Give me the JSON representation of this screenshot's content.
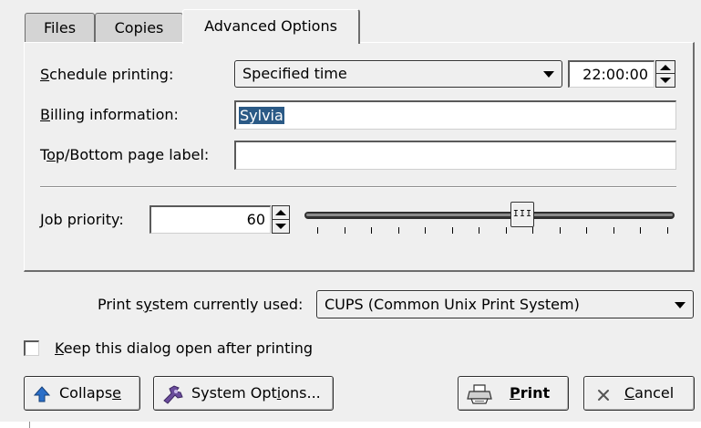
{
  "tabs": [
    {
      "label": "Files"
    },
    {
      "label": "Copies"
    },
    {
      "label": "Advanced Options"
    }
  ],
  "schedule": {
    "label_mnemonic": "S",
    "label_rest": "chedule printing:",
    "value": "Specified time",
    "time": "22:00:00"
  },
  "billing": {
    "label_mnemonic": "B",
    "label_rest": "illing information:",
    "value": "Sylvia"
  },
  "page_label": {
    "label_pre": "T",
    "label_mnemonic": "o",
    "label_rest": "p/Bottom page label:",
    "value": ""
  },
  "priority": {
    "label_mnemonic": "J",
    "label_rest": "ob priority:",
    "value": "60",
    "slider_min": 1,
    "slider_max": 100,
    "slider_value": 60,
    "tick_count": 14
  },
  "print_system": {
    "label_pre": "Print s",
    "label_mnemonic": "y",
    "label_rest": "stem currently used:",
    "value": "CUPS (Common Unix Print System)"
  },
  "keep_open": {
    "label_mnemonic": "K",
    "label_rest": "eep this dialog open after printing",
    "checked": false
  },
  "buttons": {
    "collapse": {
      "pre": "Collaps",
      "mnemonic": "e",
      "rest": "",
      "icon": "arrow-up-icon"
    },
    "system_options": {
      "pre": "System Opt",
      "mnemonic": "i",
      "rest": "ons...",
      "icon": "wrench-icon"
    },
    "print": {
      "pre": "",
      "mnemonic": "P",
      "rest": "rint",
      "icon": "printer-icon"
    },
    "cancel": {
      "pre": "",
      "mnemonic": "C",
      "rest": "ancel",
      "icon": "close-icon"
    }
  },
  "colors": {
    "window_bg": "#efefef",
    "selection_bg": "#2b5a86",
    "icon_blue": "#2a6fc9",
    "icon_purple": "#6a4c9c"
  }
}
